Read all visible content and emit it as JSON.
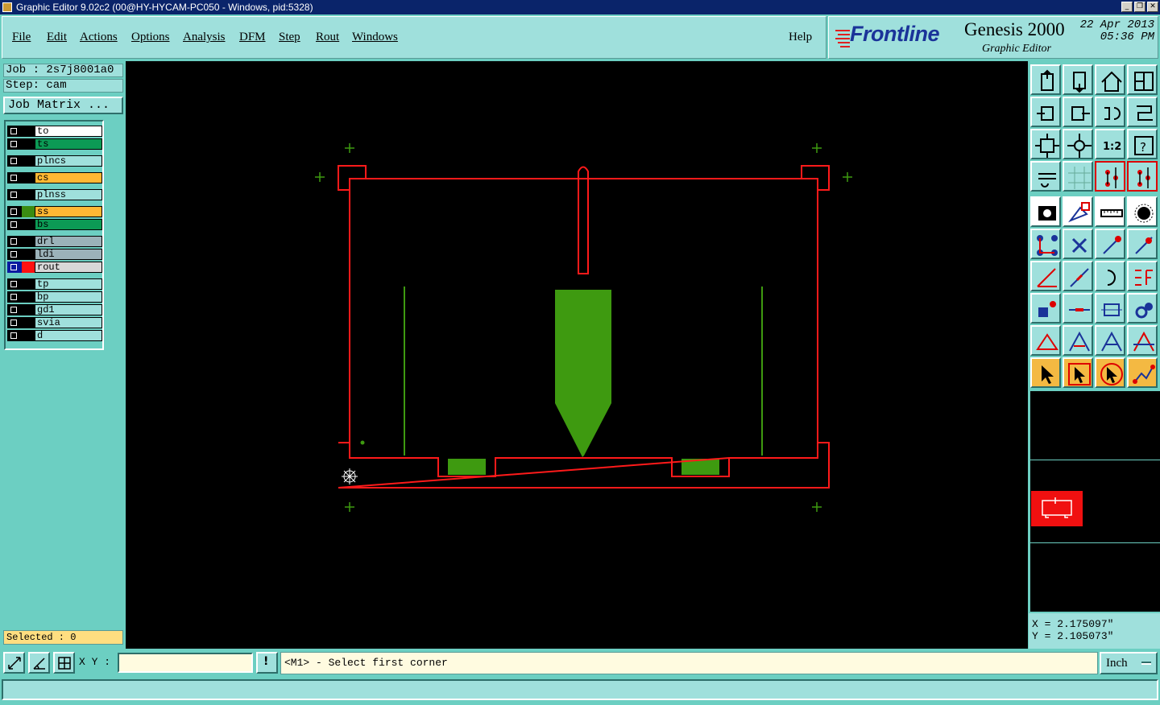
{
  "window": {
    "title": "Graphic Editor 9.02c2 (00@HY-HYCAM-PC050 - Windows, pid:5328)",
    "buttons": [
      "_",
      "❐",
      "✕"
    ]
  },
  "menu": {
    "items": [
      "File",
      "Edit",
      "Actions",
      "Options",
      "Analysis",
      "DFM",
      "Step",
      "Rout",
      "Windows"
    ],
    "help": "Help"
  },
  "brand": {
    "logo": "Frontline",
    "product": "Genesis 2000",
    "subtitle": "Graphic Editor",
    "date": "22 Apr 2013",
    "time": "05:36 PM"
  },
  "job": {
    "job_line": "Job : 2s7j8001a0",
    "step_line": "Step: cam",
    "matrix_button": "Job Matrix ..."
  },
  "layers": [
    {
      "name": "to",
      "name_bg": "#ffffff",
      "marker_color": "#000000",
      "active": false
    },
    {
      "name": "ts",
      "name_bg": "#0c9a55",
      "marker_color": "#000000",
      "active": false
    },
    {
      "name": "plncs",
      "name_bg": "#9fe0dc",
      "marker_color": "#000000",
      "active": false
    },
    {
      "name": "cs",
      "name_bg": "#ffb833",
      "marker_color": "#000000",
      "active": false
    },
    {
      "name": "plnss",
      "name_bg": "#9fe0dc",
      "marker_color": "#000000",
      "active": false
    },
    {
      "name": "ss",
      "name_bg": "#ffb833",
      "marker_color": "#3a8c12",
      "active": false
    },
    {
      "name": "bs",
      "name_bg": "#0c9a55",
      "marker_color": "#000000",
      "active": false
    },
    {
      "name": "drl",
      "name_bg": "#9bb2b9",
      "marker_color": "#000000",
      "active": false
    },
    {
      "name": "ldi",
      "name_bg": "#9bb2b9",
      "marker_color": "#000000",
      "active": false
    },
    {
      "name": "rout",
      "name_bg": "#d8d8d8",
      "marker_color": "#ff1010",
      "active": true
    },
    {
      "name": "tp",
      "name_bg": "#9fe0dc",
      "marker_color": "#000000",
      "active": false
    },
    {
      "name": "bp",
      "name_bg": "#9fe0dc",
      "marker_color": "#000000",
      "active": false
    },
    {
      "name": "gd1",
      "name_bg": "#9fe0dc",
      "marker_color": "#000000",
      "active": false
    },
    {
      "name": "svia",
      "name_bg": "#9fe0dc",
      "marker_color": "#000000",
      "active": false
    },
    {
      "name": "d",
      "name_bg": "#9fe0dc",
      "marker_color": "#000000",
      "active": false
    }
  ],
  "selected": "Selected : 0",
  "coords": {
    "x_line": "X = 2.175097\"",
    "y_line": "Y = 2.105073\""
  },
  "bottom": {
    "xy_label": "X Y :",
    "xy_value": "",
    "message": "<M1> - Select first corner",
    "units": "Inch",
    "warn_icon": "!"
  },
  "colors": {
    "rout_outline": "#ff1a1a",
    "copper_green": "#3e9a10",
    "panel_bg": "#6ccfc2",
    "button_bg": "#9fe0dc"
  },
  "toolbar_icons": [
    "zoom-home-icon",
    "zoom-step-icon",
    "home-icon",
    "window-icon",
    "pan-left-icon",
    "pan-right-icon",
    "undo-icon",
    "redraw-icon",
    "zoom-fit-icon",
    "zoom-center-icon",
    "scale-1-2-icon",
    "help-query-icon",
    "measure-tools-icon",
    "grid-icon",
    "snap-icon",
    "snap-alt-icon",
    "select-pad-icon",
    "select-shape-icon",
    "ruler-icon",
    "point-icon",
    "connect-icon",
    "cross-icon",
    "line-point-icon",
    "line-point-alt-icon",
    "angle-icon",
    "line-icon",
    "arc-icon",
    "mirror-f-icon",
    "pad-select-icon",
    "minus-icon",
    "dimension-icon",
    "circles-icon",
    "triangle-a-icon",
    "triangle-b-icon",
    "triangle-c-icon",
    "triangle-d-icon",
    "cursor-icon",
    "cursor-box-icon",
    "cursor-circle-icon",
    "route-icon"
  ]
}
